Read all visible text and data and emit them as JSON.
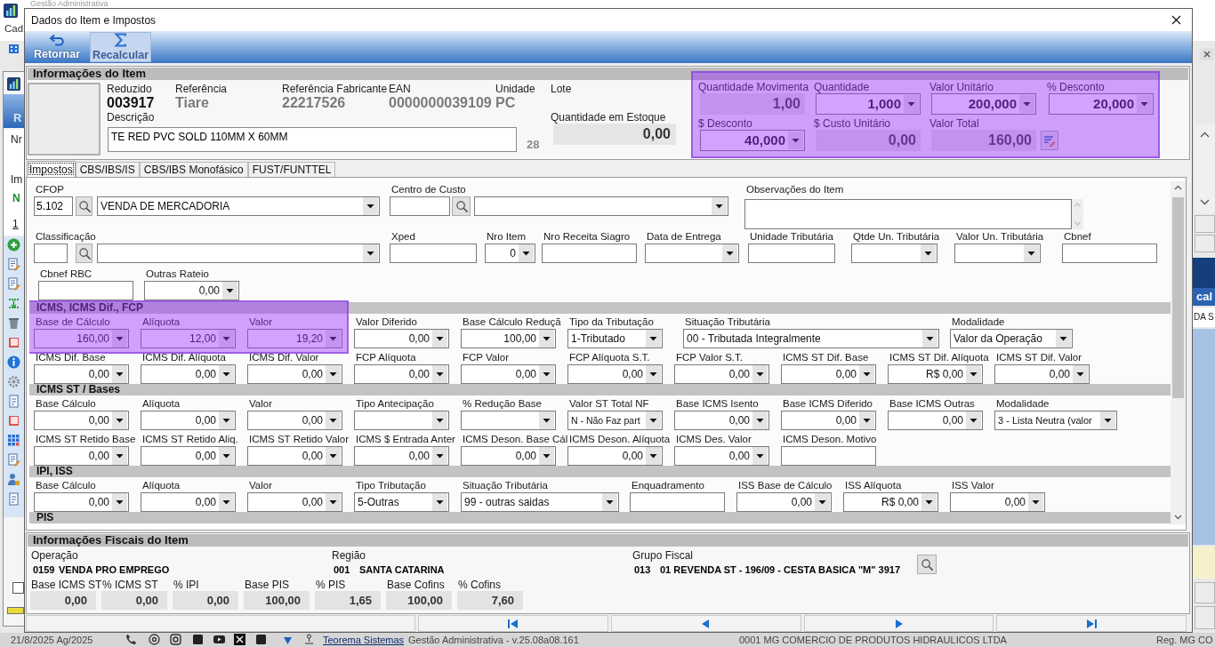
{
  "app": {
    "title": "Gestão Administrativa",
    "menu": [
      "Cad"
    ],
    "left_texts": [
      "R",
      "Nr",
      "Im",
      "N",
      "1"
    ],
    "checkbox": {
      "checked": false
    },
    "right_texts": [
      "cal",
      "DA S"
    ],
    "status_bar": {
      "date": "21/8/2025 Ag/2025",
      "link": "Teorema Sistemas",
      "version": "Gestão Administrativa - v.25.08a08.161",
      "company": "0001 MG COMERCIO DE PRODUTOS HIDRAULICOS LTDA",
      "region": "Reg. MG CO"
    }
  },
  "dialog": {
    "title": "Dados do Item e Impostos",
    "toolbar": [
      {
        "label": "Retornar",
        "kind": "return",
        "highlighted": false
      },
      {
        "label": "Recalcular",
        "kind": "sigma",
        "highlighted": true
      }
    ],
    "item_info": {
      "title": "Informações do Item",
      "codes": [
        {
          "label": "Reduzido",
          "value": "003917",
          "kind": "primary"
        },
        {
          "label": "Referência",
          "value": "Tiare",
          "kind": "secondary"
        },
        {
          "label": "Referência Fabricante",
          "value": "22217526",
          "kind": "secondary"
        },
        {
          "label": "EAN",
          "value": "0000000039109",
          "kind": "secondary"
        },
        {
          "label": "Unidade",
          "value": "PC",
          "kind": "secondary"
        },
        {
          "label": "Lote"
        }
      ],
      "description": {
        "label": "Descrição",
        "value": "TE RED PVC SOLD 110MM X 60MM",
        "count": "28"
      },
      "stock": {
        "label": "Quantidade em Estoque",
        "value": "0,00"
      },
      "quantities": {
        "highlighted": true,
        "fields": [
          {
            "label": "Quantidade Movimenta",
            "kind": "readonly",
            "value": "1,00"
          },
          {
            "label": "Quantidade",
            "kind": "combo",
            "value": "1,000"
          },
          {
            "label": "Valor Unitário",
            "kind": "combo",
            "value": "200,000"
          },
          {
            "label": "% Desconto",
            "kind": "combo",
            "value": "20,000"
          },
          {
            "label": "$ Desconto",
            "kind": "combo",
            "value": "40,000"
          },
          {
            "label": "$ Custo Unitário",
            "kind": "readonly",
            "value": "0,00"
          },
          {
            "label": "Valor Total",
            "kind": "readonly_action",
            "value": "160,00"
          }
        ]
      }
    },
    "tabs": [
      {
        "label": "Impostos",
        "selected": true
      },
      {
        "label": "CBS/IBS/IS",
        "selected": false
      },
      {
        "label": "CBS/IBS Monofásico",
        "selected": false
      },
      {
        "label": "FUST/FUNTTEL",
        "selected": false
      }
    ],
    "general": {
      "fields": [
        {
          "label": "CFOP",
          "kind": "lookup",
          "code": "5.102",
          "value": "VENDA DE MERCADORIA"
        },
        {
          "label": "Centro de Custo",
          "kind": "lookup"
        },
        {
          "label": "Observações do Item",
          "kind": "memo"
        },
        {
          "label": "Classificação",
          "kind": "lookup"
        },
        {
          "label": "Xped",
          "kind": "input"
        },
        {
          "label": "Nro Item",
          "kind": "combo",
          "value": "0"
        },
        {
          "label": "Nro Receita Siagro",
          "kind": "input"
        },
        {
          "label": "Data de Entrega",
          "kind": "combo"
        },
        {
          "label": "Unidade Tributária",
          "kind": "input"
        },
        {
          "label": "Qtde Un. Tributária",
          "kind": "combo"
        },
        {
          "label": "Valor Un. Tributária",
          "kind": "combo"
        },
        {
          "label": "Cbnef",
          "kind": "input"
        },
        {
          "label": "Cbnef RBC",
          "kind": "input"
        },
        {
          "label": "Outras Rateio",
          "kind": "combo",
          "value": "0,00"
        }
      ]
    },
    "sections": [
      {
        "title": "ICMS, ICMS Dif., FCP",
        "rows": [
          [
            {
              "label": "Base de Cálculo",
              "kind": "combo",
              "value": "160,00",
              "highlighted": true
            },
            {
              "label": "Alíquota",
              "kind": "combo",
              "value": "12,00",
              "highlighted": true
            },
            {
              "label": "Valor",
              "kind": "combo",
              "value": "19,20",
              "highlighted": true
            },
            {
              "label": "Valor Diferido",
              "kind": "combo",
              "value": "0,00",
              "highlighted": false
            },
            {
              "label": "Base Cálculo Reduçã",
              "kind": "combo",
              "value": "100,00",
              "highlighted": false
            },
            {
              "label": "Tipo da Tributação",
              "kind": "select",
              "value": "1-Tributado",
              "highlighted": false
            },
            {
              "label": "Situação Tributária",
              "kind": "select",
              "value": "00 - Tributada Integralmente",
              "highlighted": false
            },
            {
              "label": "Modalidade",
              "kind": "select",
              "value": "Valor da Operação",
              "highlighted": false
            }
          ],
          [
            {
              "label": "ICMS Dif. Base",
              "kind": "combo",
              "value": "0,00"
            },
            {
              "label": "ICMS Dif. Alíquota",
              "kind": "combo",
              "value": "0,00"
            },
            {
              "label": "ICMS Dif. Valor",
              "kind": "combo",
              "value": "0,00"
            },
            {
              "label": "FCP Alíquota",
              "kind": "combo",
              "value": "0,00"
            },
            {
              "label": "FCP Valor",
              "kind": "combo",
              "value": "0,00"
            },
            {
              "label": "FCP Alíquota S.T.",
              "kind": "combo",
              "value": "0,00"
            },
            {
              "label": "FCP Valor S.T.",
              "kind": "combo",
              "value": "0,00"
            },
            {
              "label": "ICMS ST Dif. Base",
              "kind": "combo",
              "value": "0,00"
            },
            {
              "label": "ICMS ST Dif. Alíquota",
              "kind": "combo",
              "value": "R$ 0,00"
            },
            {
              "label": "ICMS ST Dif. Valor",
              "kind": "combo",
              "value": "0,00"
            }
          ]
        ]
      },
      {
        "title": "ICMS ST / Bases",
        "rows": [
          [
            {
              "label": "Base Cálculo",
              "kind": "combo",
              "value": "0,00"
            },
            {
              "label": "Alíquota",
              "kind": "combo",
              "value": "0,00"
            },
            {
              "label": "Valor",
              "kind": "combo",
              "value": "0,00"
            },
            {
              "label": "Tipo Antecipação",
              "kind": "select"
            },
            {
              "label": "% Redução Base",
              "kind": "combo"
            },
            {
              "label": "Valor ST Total NF",
              "kind": "select",
              "value": "N - Não Faz part"
            },
            {
              "label": "Base ICMS Isento",
              "kind": "combo",
              "value": "0,00"
            },
            {
              "label": "Base ICMS Diferido",
              "kind": "combo",
              "value": "0,00"
            },
            {
              "label": "Base ICMS Outras",
              "kind": "combo",
              "value": "0,00"
            },
            {
              "label": "Modalidade",
              "kind": "select",
              "value": "3 - Lista Neutra (valor"
            }
          ],
          [
            {
              "label": "ICMS ST Retido Base",
              "kind": "combo",
              "value": "0,00"
            },
            {
              "label": "ICMS ST Retido Aliq.",
              "kind": "combo",
              "value": "0,00"
            },
            {
              "label": "ICMS ST Retido Valor",
              "kind": "combo",
              "value": "0,00"
            },
            {
              "label": "ICMS $ Entrada Anter",
              "kind": "combo",
              "value": "0,00"
            },
            {
              "label": "ICMS Deson. Base Cál",
              "kind": "combo",
              "value": "0,00"
            },
            {
              "label": "ICMS Deson. Alíquota",
              "kind": "combo",
              "value": "0,00"
            },
            {
              "label": "ICMS Des. Valor",
              "kind": "combo",
              "value": "0,00"
            },
            {
              "label": "ICMS Deson. Motivo",
              "kind": "input"
            }
          ]
        ]
      },
      {
        "title": "IPI, ISS",
        "rows": [
          [
            {
              "label": "Base Cálculo",
              "kind": "combo",
              "value": "0,00"
            },
            {
              "label": "Alíquota",
              "kind": "combo",
              "value": "0,00"
            },
            {
              "label": "Valor",
              "kind": "combo",
              "value": "0,00"
            },
            {
              "label": "Tipo Tributação",
              "kind": "select",
              "value": "5-Outras"
            },
            {
              "label": "Situação Tributária",
              "kind": "select",
              "value": "99 - outras saidas"
            },
            {
              "label": "Enquadramento",
              "kind": "input"
            },
            {
              "label": "ISS Base de Cálculo",
              "kind": "combo",
              "value": "0,00"
            },
            {
              "label": "ISS Alíquota",
              "kind": "combo",
              "value": "R$ 0,00"
            },
            {
              "label": "ISS Valor",
              "kind": "combo",
              "value": "0,00"
            }
          ]
        ]
      },
      {
        "title": "PIS"
      }
    ],
    "fiscal": {
      "title": "Informações Fiscais do Item",
      "groups": [
        {
          "label": "Operação",
          "code": "0159",
          "value": "VENDA PRO EMPREGO"
        },
        {
          "label": "Região",
          "code": "001",
          "value": "SANTA CATARINA"
        },
        {
          "label": "Grupo Fiscal",
          "code": "013",
          "value": "01 REVENDA ST - 196/09 - CESTA BASICA \"M\" 3917"
        }
      ],
      "totals": [
        {
          "label": "Base ICMS ST",
          "value": "0,00"
        },
        {
          "label": "% ICMS ST",
          "value": "0,00"
        },
        {
          "label": "% IPI",
          "value": "0,00"
        },
        {
          "label": "Base PIS",
          "value": "100,00"
        },
        {
          "label": "% PIS",
          "value": "1,65"
        },
        {
          "label": "Base Cofins",
          "value": "100,00"
        },
        {
          "label": "% Cofins",
          "value": "7,60"
        }
      ]
    },
    "navigation": [
      {
        "kind": "first"
      },
      {
        "kind": "previous"
      },
      {
        "kind": "next"
      },
      {
        "kind": "last"
      }
    ]
  }
}
